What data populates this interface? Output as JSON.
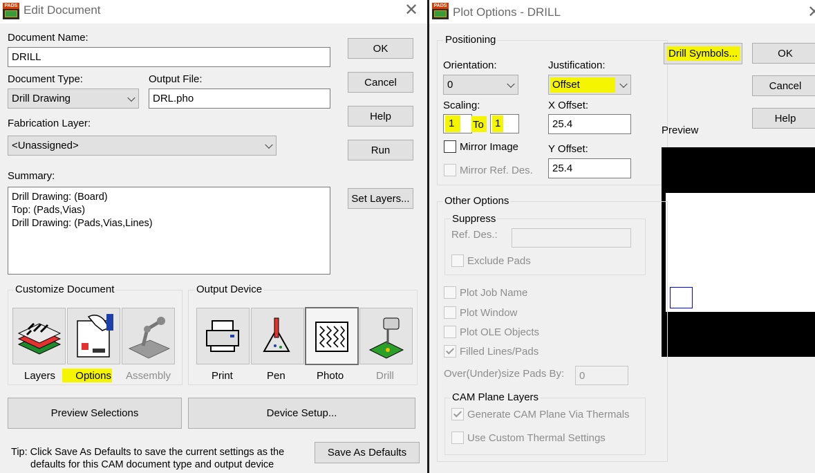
{
  "edit_document": {
    "title": "Edit Document",
    "app_icon_text": "PADS",
    "close": "✕",
    "document_name_label": "Document Name:",
    "document_name_value": "DRILL",
    "document_type_label": "Document Type:",
    "document_type_value": "Drill Drawing",
    "output_file_label": "Output File:",
    "output_file_value": "DRL.pho",
    "fabrication_layer_label": "Fabrication Layer:",
    "fabrication_layer_value": "<Unassigned>",
    "summary_label": "Summary:",
    "summary_lines": [
      "Drill Drawing: (Board)",
      "Top: (Pads,Vias)",
      "Drill Drawing: (Pads,Vias,Lines)"
    ],
    "buttons": {
      "ok": "OK",
      "cancel": "Cancel",
      "help": "Help",
      "run": "Run",
      "set_layers": "Set Layers..."
    },
    "customize_document": {
      "title": "Customize Document",
      "items": [
        {
          "label": "Layers",
          "icon": "layers-icon",
          "enabled": true
        },
        {
          "label": "Options",
          "icon": "options-icon",
          "enabled": true,
          "highlighted": true
        },
        {
          "label": "Assembly",
          "icon": "assembly-icon",
          "enabled": false
        }
      ]
    },
    "output_device": {
      "title": "Output Device",
      "items": [
        {
          "label": "Print",
          "icon": "printer-icon",
          "enabled": true
        },
        {
          "label": "Pen",
          "icon": "pen-plotter-icon",
          "enabled": true
        },
        {
          "label": "Photo",
          "icon": "photo-plotter-icon",
          "enabled": true,
          "selected": true
        },
        {
          "label": "Drill",
          "icon": "drill-icon",
          "enabled": false
        }
      ]
    },
    "preview_selections": "Preview Selections",
    "device_setup": "Device Setup...",
    "tip_line1": "Tip: Click Save As Defaults to save the current settings as the",
    "tip_line2": "defaults for this CAM document type and output device",
    "save_as_defaults": "Save As Defaults"
  },
  "plot_options": {
    "title": "Plot Options - DRILL",
    "app_icon_text": "PADS",
    "close": "✕",
    "positioning": {
      "title": "Positioning",
      "orientation_label": "Orientation:",
      "orientation_value": "0",
      "justification_label": "Justification:",
      "justification_value": "Offset",
      "scaling_label": "Scaling:",
      "scale_from": "1",
      "scale_to_label": "To",
      "scale_to": "1",
      "x_offset_label": "X Offset:",
      "x_offset_value": "25.4",
      "y_offset_label": "Y Offset:",
      "y_offset_value": "25.4",
      "mirror_image": "Mirror Image",
      "mirror_ref_des": "Mirror Ref. Des."
    },
    "buttons": {
      "drill_symbols": "Drill Symbols...",
      "ok": "OK",
      "cancel": "Cancel",
      "help": "Help"
    },
    "preview_label": "Preview",
    "other_options": {
      "title": "Other Options",
      "suppress_title": "Suppress",
      "ref_des_label": "Ref. Des.:",
      "exclude_pads": "Exclude Pads",
      "plot_job_name": "Plot Job Name",
      "plot_window": "Plot Window",
      "plot_ole_objects": "Plot OLE Objects",
      "filled_lines_pads": "Filled Lines/Pads",
      "oversize_label": "Over(Under)size Pads By:",
      "oversize_value": "0",
      "cam_plane_title": "CAM Plane Layers",
      "generate_cam_plane": "Generate CAM Plane Via Thermals",
      "use_custom_thermal": "Use Custom Thermal Settings"
    }
  },
  "colors": {
    "highlight": "#f5f500",
    "preview_outline": "#0000ff"
  }
}
